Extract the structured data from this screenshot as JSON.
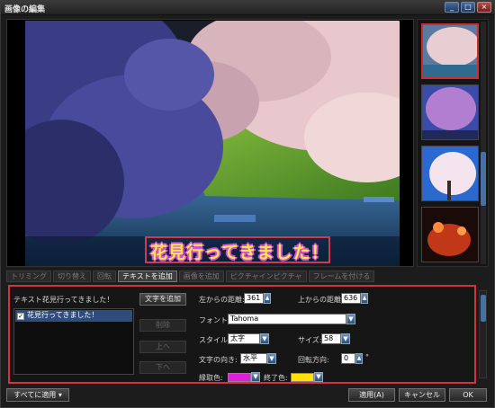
{
  "window": {
    "title": "画像の編集"
  },
  "window_controls": {
    "minimize": "_",
    "maximize": "□",
    "close": "×"
  },
  "preview": {
    "overlay_text": "花見行ってきました！"
  },
  "tabs": [
    {
      "label": "トリミング",
      "active": false
    },
    {
      "label": "切り替え",
      "active": false
    },
    {
      "label": "回転",
      "active": false
    },
    {
      "label": "テキストを追加",
      "active": true
    },
    {
      "label": "画像を追加",
      "active": false
    },
    {
      "label": "ピクチャインピクチャ",
      "active": false
    },
    {
      "label": "フレームを付ける",
      "active": false
    }
  ],
  "panel": {
    "text_label": "テキスト:",
    "text_value": "花見行ってきました！",
    "add_text_button": "文字を追加",
    "list_items": [
      {
        "label": "花見行ってきました！",
        "checked": true
      }
    ],
    "delete_button": "削除",
    "up_button": "上へ",
    "down_button": "下へ",
    "left_distance_label": "左からの距離:",
    "left_distance_value": "361",
    "top_distance_label": "上からの距離:",
    "top_distance_value": "636",
    "font_label": "フォント:",
    "font_value": "Tahoma",
    "style_label": "スタイル:",
    "style_value": "太字",
    "size_label": "サイズ:",
    "size_value": "58",
    "direction_label": "文字の向き:",
    "direction_value": "水平",
    "rotation_label": "回転方向:",
    "rotation_value": "0",
    "rotation_unit": "°",
    "border_color_label": "縁取色:",
    "end_color_label": "終了色:"
  },
  "colors": {
    "border_color": "#e020d8",
    "end_color": "#ffe000",
    "accent_red": "#d0343e"
  },
  "bottom": {
    "apply_all_button": "すべてに適用",
    "apply_button": "適用(A)",
    "cancel_button": "キャンセル",
    "ok_button": "OK"
  }
}
